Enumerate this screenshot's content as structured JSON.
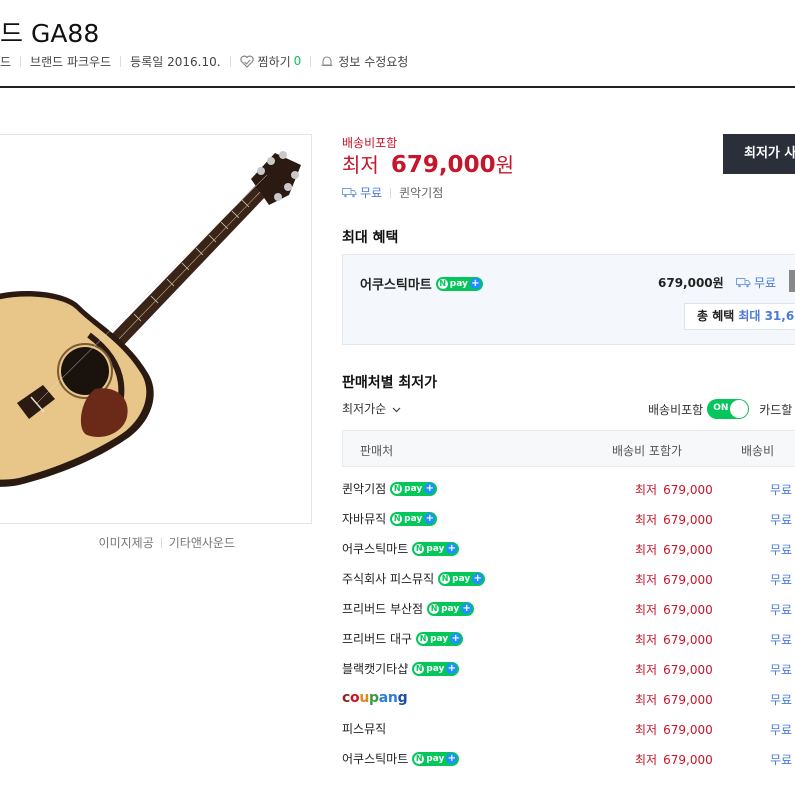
{
  "header": {
    "title": "드 GA88",
    "meta": {
      "brand_fragment": "드",
      "brand": "브랜드 파크우드",
      "registered": "등록일 2016.10.",
      "wish_label": "찜하기",
      "wish_count": "0",
      "report": "정보 수정요청"
    }
  },
  "image": {
    "credit_label": "이미지제공",
    "credit_source": "기타앤사운드",
    "accent_colors": {
      "top": "#e8c68a",
      "binding": "#2a1a12",
      "pickguard": "#6b2a17"
    }
  },
  "price": {
    "shipping_included": "배송비포함",
    "lowest_label": "최저",
    "amount": "679,000",
    "currency": "원",
    "shipping": "무료",
    "seller": "퀸악기점",
    "buy_button": "최저가 사"
  },
  "max_benefit": {
    "title": "최대 혜택",
    "shop": "어쿠스틱마트",
    "price": "679,000원",
    "shipping": "무료",
    "total_label": "총 혜택",
    "total_value": "최대 31,6"
  },
  "npay": {
    "text": "pay",
    "n": "N",
    "plus": "+"
  },
  "seller_list": {
    "title": "판매처별 최저가",
    "sort_label": "최저가순",
    "toggle_label": "배송비포함",
    "toggle_state": "ON",
    "card_label": "카드할",
    "columns": [
      "판매처",
      "배송비 포함가",
      "배송비"
    ],
    "price_prefix": "최저",
    "rows": [
      {
        "name": "퀸악기점",
        "npay": true,
        "price": "679,000",
        "shipping": "무료"
      },
      {
        "name": "자바뮤직",
        "npay": true,
        "price": "679,000",
        "shipping": "무료"
      },
      {
        "name": "어쿠스틱마트",
        "npay": true,
        "price": "679,000",
        "shipping": "무료"
      },
      {
        "name": "주식회사 피스뮤직",
        "npay": true,
        "price": "679,000",
        "shipping": "무료"
      },
      {
        "name": "프리버드 부산점",
        "npay": true,
        "price": "679,000",
        "shipping": "무료"
      },
      {
        "name": "프리버드 대구",
        "npay": true,
        "price": "679,000",
        "shipping": "무료"
      },
      {
        "name": "블랙캣기타샵",
        "npay": true,
        "price": "679,000",
        "shipping": "무료"
      },
      {
        "name": "coupang",
        "npay": false,
        "logo": true,
        "price": "679,000",
        "shipping": "무료"
      },
      {
        "name": "피스뮤직",
        "npay": false,
        "price": "679,000",
        "shipping": "무료"
      },
      {
        "name": "어쿠스틱마트",
        "npay": true,
        "price": "679,000",
        "shipping": "무료"
      }
    ]
  },
  "colors": {
    "price_red": "#c7152b",
    "naver_green": "#03c75a",
    "link_blue": "#4a7bd8",
    "dark_button": "#2b2f3a"
  }
}
